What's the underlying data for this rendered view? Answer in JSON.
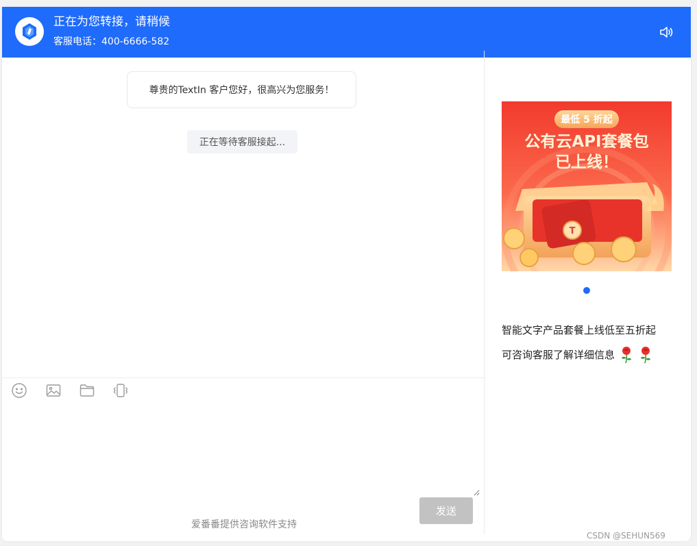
{
  "header": {
    "title": "正在为您转接，请稍候",
    "phone_label": "客服电话：",
    "phone_number": "400-6666-582",
    "logo_icon": "chat-logo-icon",
    "sound_icon": "speaker-icon",
    "brand_color": "#1f6bfb"
  },
  "chat": {
    "greeting": "尊贵的TextIn 客户您好，很高兴为您服务！",
    "status": "正在等待客服接起..."
  },
  "toolbar": {
    "icons": [
      "emoji-icon",
      "image-icon",
      "folder-icon",
      "vibrate-icon"
    ]
  },
  "composer": {
    "send_label": "发送",
    "powered_by": "爱番番提供咨询软件支持"
  },
  "sidebar": {
    "banner": {
      "tag": "最低 5 折起",
      "headline_line1": "公有云API套餐包",
      "headline_line2": "已上线！"
    },
    "carousel_pages": 1,
    "carousel_active": 1,
    "promo_line1": "智能文字产品套餐上线低至五折起",
    "promo_line2": "可咨询客服了解详细信息",
    "promo_icons": [
      "rose-icon",
      "rose-icon"
    ]
  },
  "watermark": "CSDN @SEHUN569"
}
